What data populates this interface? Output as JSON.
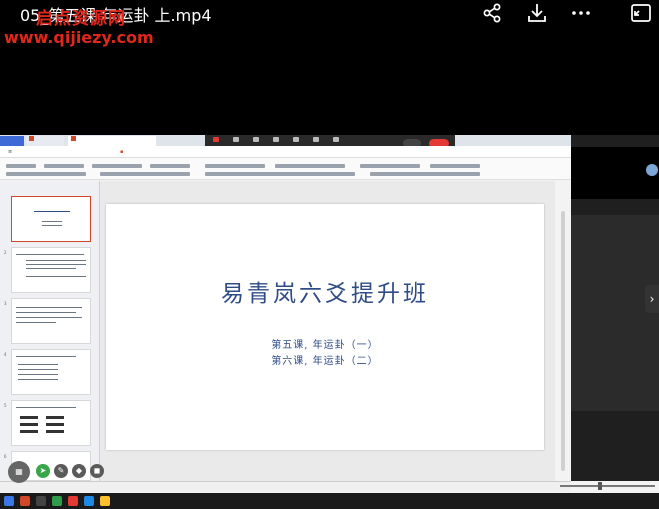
{
  "player": {
    "title": "05_第五课 年运卦 上.mp4",
    "watermark_site_name": "启点资源网",
    "watermark_url": "www.qijiezy.com",
    "icons": [
      "share-icon",
      "download-icon",
      "more-icon",
      "exit-fullscreen-icon"
    ]
  },
  "slide": {
    "title": "易青岚六爻提升班",
    "subtitle_line1": "第五课, 年运卦（一）",
    "subtitle_line2": "第六课, 年运卦（二）"
  },
  "colors": {
    "watermark": "#e1261c",
    "slide_text": "#2f4c86",
    "accent_wps": "#d24726",
    "meeting_leave": "#e53935"
  }
}
